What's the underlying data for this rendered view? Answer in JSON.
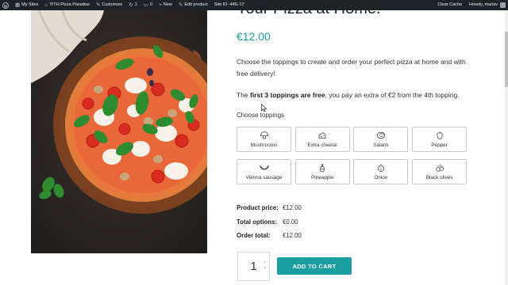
{
  "adminbar": {
    "my_sites": "My Sites",
    "site_name": "YITH Pizza Paradise",
    "customize": "Customize",
    "updates_count": "1",
    "comments_count": "0",
    "new": "New",
    "edit_product": "Edit product",
    "site_id": "Site ID: 445913",
    "clear_cache": "Clear Cache",
    "howdy": "Howdy, mariav"
  },
  "product": {
    "title": "Your Pizza at Home!",
    "price": "€12.00",
    "description": "Choose the toppings to create and order your perfect pizza at home and with free delivery!",
    "free_prefix": "The ",
    "free_bold": "first 3 toppings are free",
    "free_suffix": ", you pay an extra of €2 from the 4th topping.",
    "choose_label": "Choose toppings",
    "toppings": [
      {
        "label": "Mushrooms",
        "icon": "mushroom-icon"
      },
      {
        "label": "Extra cheese",
        "icon": "cheese-icon"
      },
      {
        "label": "Salami",
        "icon": "salami-icon"
      },
      {
        "label": "Pepper",
        "icon": "pepper-icon"
      },
      {
        "label": "Vienna sausage",
        "icon": "sausage-icon"
      },
      {
        "label": "Pineapple",
        "icon": "pineapple-icon"
      },
      {
        "label": "Onion",
        "icon": "onion-icon"
      },
      {
        "label": "Black olives",
        "icon": "olives-icon"
      }
    ],
    "summary": {
      "product_price_label": "Product price:",
      "product_price": "€12.00",
      "total_options_label": "Total options:",
      "total_options": "€0.00",
      "order_total_label": "Order total:",
      "order_total": "€12.00"
    },
    "quantity": "1",
    "add_to_cart": "ADD TO CART"
  },
  "colors": {
    "accent": "#1a9ea0",
    "adminbar": "#1d2327"
  }
}
